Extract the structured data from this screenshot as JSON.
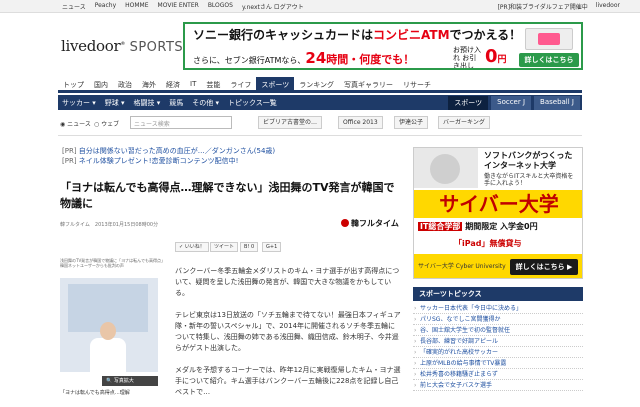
{
  "topbar": {
    "left": [
      "ニュース",
      "Peachy",
      "HOMME",
      "MOVIE ENTER",
      "BLOGOS",
      "y.nextさん ログアウト"
    ],
    "right": [
      "[PR]和装ブライダルフェア開催中",
      "livedoor"
    ]
  },
  "logo": {
    "brand": "livedoor",
    "section": "SPORTS"
  },
  "banner": {
    "line1_a": "ソニー銀行",
    "line1_b": "のキャッシュカードは",
    "line1_c": "コンビニATM",
    "line1_d": "でつかえる！",
    "line2_a": "さらに、セブン銀行ATMなら、",
    "line2_b": "24",
    "line2_c": "時間・何度でも！",
    "fee_label": "お預け入れ お引き出し 手数料",
    "zero": "0",
    "zero_unit": "円",
    "detail_button": "詳しくはこちら"
  },
  "main_nav": {
    "items": [
      "トップ",
      "国内",
      "政治",
      "海外",
      "経済",
      "IT",
      "芸能",
      "ライフ",
      "スポーツ",
      "ランキング",
      "写真ギャラリー",
      "リサーチ"
    ],
    "active_index": 8
  },
  "sub_nav": {
    "items": [
      "サッカー ▾",
      "野球 ▾",
      "格闘技 ▾",
      "競馬",
      "その他 ▾",
      "トピックス一覧"
    ],
    "tabs": [
      "スポーツ",
      "Soccer J",
      "Baseball J"
    ],
    "active_tab": 0
  },
  "search": {
    "radio_news": "◉ ニュース",
    "radio_web": "○ ウェブ",
    "placeholder": "ニュース検索",
    "tags": [
      "ビブリア古書堂の…",
      "Office 2013",
      "伊達公子",
      "バーガーキング"
    ]
  },
  "pr": [
    {
      "tag": "[PR]",
      "text": "自分は関係ない習だった高めの血圧が…／ダンガンさん(54歳)"
    },
    {
      "tag": "[PR]",
      "text": "ネイル体験プレゼント!恋愛診断コンテンツ配信中!"
    }
  ],
  "article": {
    "headline": "「ヨナは転んでも高得点…理解できない」浅田舞のTV発言が韓国で物議に",
    "meta": "韓フルタイム　2013年01月15日08時00分",
    "source_logo": "韓フルタイム",
    "social": [
      "✓ いいね！",
      "ツイート",
      "B! 0",
      "G+1"
    ],
    "photo_caption_top_1": "浅田舞のTV発言が韓国で物議に「ヨナは転んでも高得点」",
    "photo_caption_top_2": "韓国ネットユーザーからも批判の声",
    "photo_enlarge": "写真拡大",
    "photo_caption": "「ヨナは転んでも高得点…理解",
    "paragraphs": [
      "バンクーバー冬季五輪金メダリストのキム・ヨナ選手が出す高得点について、疑問を呈した浅田舞の発言が、韓国で大きな物議をかもしている。",
      "テレビ東京は13日放送の「ソチ五輪まで待てない！最強日本フィギュア隊・新年の誓いスペシャル」で、2014年に開催されるソチ冬季五輪について特集し、浅田舞の姉である浅田舞、織田信成、鈴木明子、今井遥らがゲスト出演した。",
      "メダルを予想するコーナーでは、昨年12月に実戦復帰したキム・ヨナ選手について紹介。キム選手はバンクーバー五輪後に228点を記録し自己ベストで…"
    ]
  },
  "right_ad": {
    "line1": "ソフトバンクがつくった",
    "line1b": "インターネット大学",
    "line2a": "働きながらITスキルと大卒資格を",
    "line2b": "手に入れよう！",
    "big": "サイバー大学",
    "line3_hl": "IT総合学部",
    "line3": "期間限定 入学金0円",
    "ipad": "「iPad」無償貸与",
    "foot_logo": "サイバー大学 Cyber University",
    "button": "詳しくはこちら ▶"
  },
  "topics": {
    "title": "スポーツトピックス",
    "items": [
      "サッカー日本代表「今日中に決める」",
      "パリSG、なでしこ宮間獲得か",
      "谷、国士舘大学生で初の監督就任",
      "長谷部、練習で好調アピール",
      "「確実的がれた高校サッカー",
      "上原がMLBの給与事情でTV暴露",
      "松井秀喜の移籍騒ぎ止まらず",
      "前ヒ大会で女子バスケ選手"
    ]
  },
  "colors": {
    "nav_navy": "#1e3a68",
    "banner_green": "#2b9a4a",
    "accent_red": "#e60012",
    "ad_yellow": "#ffd800",
    "link_blue": "#1e4fa0"
  }
}
